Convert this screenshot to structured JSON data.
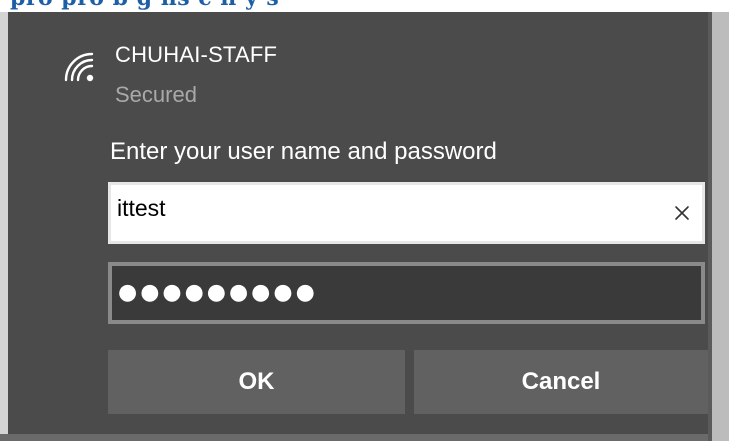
{
  "connection": {
    "network_name": "CHUHAI-STAFF",
    "status": "Secured",
    "prompt": "Enter your user name and password"
  },
  "fields": {
    "username_value": "ittest",
    "password_masked": "●●●●●●●●●"
  },
  "buttons": {
    "ok_label": "OK",
    "cancel_label": "Cancel"
  },
  "icons": {
    "network": "wifi-signal-icon",
    "clear": "close-icon"
  },
  "colors": {
    "panel_bg": "#4b4b4b",
    "button_bg": "#616161",
    "status_text": "#a9a9a9"
  }
}
